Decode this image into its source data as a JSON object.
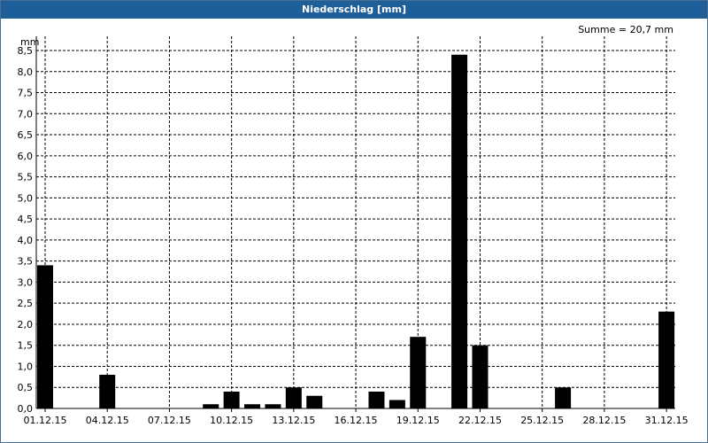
{
  "window": {
    "title": "Niederschlag [mm]"
  },
  "colors": {
    "titlebar": "#1f5f99",
    "bar": "#000000",
    "grid": "#000000"
  },
  "chart_data": {
    "type": "bar",
    "title": "Niederschlag [mm]",
    "ylabel": "mm",
    "annotation": "Summe = 20,7 mm",
    "ylim": [
      0,
      8.5
    ],
    "yticks": [
      "0,0",
      "0,5",
      "1,0",
      "1,5",
      "2,0",
      "2,5",
      "3,0",
      "3,5",
      "4,0",
      "4,5",
      "5,0",
      "5,5",
      "6,0",
      "6,5",
      "7,0",
      "7,5",
      "8,0",
      "8,5"
    ],
    "ytick_values": [
      0,
      0.5,
      1,
      1.5,
      2,
      2.5,
      3,
      3.5,
      4,
      4.5,
      5,
      5.5,
      6,
      6.5,
      7,
      7.5,
      8,
      8.5
    ],
    "xticks": [
      "01.12.15",
      "04.12.15",
      "07.12.15",
      "10.12.15",
      "13.12.15",
      "16.12.15",
      "19.12.15",
      "22.12.15",
      "25.12.15",
      "28.12.15",
      "31.12.15"
    ],
    "grid": true,
    "categories": [
      "01.12.15",
      "02.12.15",
      "03.12.15",
      "04.12.15",
      "05.12.15",
      "06.12.15",
      "07.12.15",
      "08.12.15",
      "09.12.15",
      "10.12.15",
      "11.12.15",
      "12.12.15",
      "13.12.15",
      "14.12.15",
      "15.12.15",
      "16.12.15",
      "17.12.15",
      "18.12.15",
      "19.12.15",
      "20.12.15",
      "21.12.15",
      "22.12.15",
      "23.12.15",
      "24.12.15",
      "25.12.15",
      "26.12.15",
      "27.12.15",
      "28.12.15",
      "29.12.15",
      "30.12.15",
      "31.12.15"
    ],
    "values": [
      3.4,
      0,
      0,
      0.8,
      0,
      0,
      0,
      0,
      0.1,
      0.4,
      0.1,
      0.1,
      0.5,
      0.3,
      0,
      0,
      0.4,
      0.2,
      1.7,
      0,
      8.4,
      1.5,
      0,
      0,
      0,
      0.5,
      0,
      0,
      0,
      0,
      2.3
    ]
  }
}
